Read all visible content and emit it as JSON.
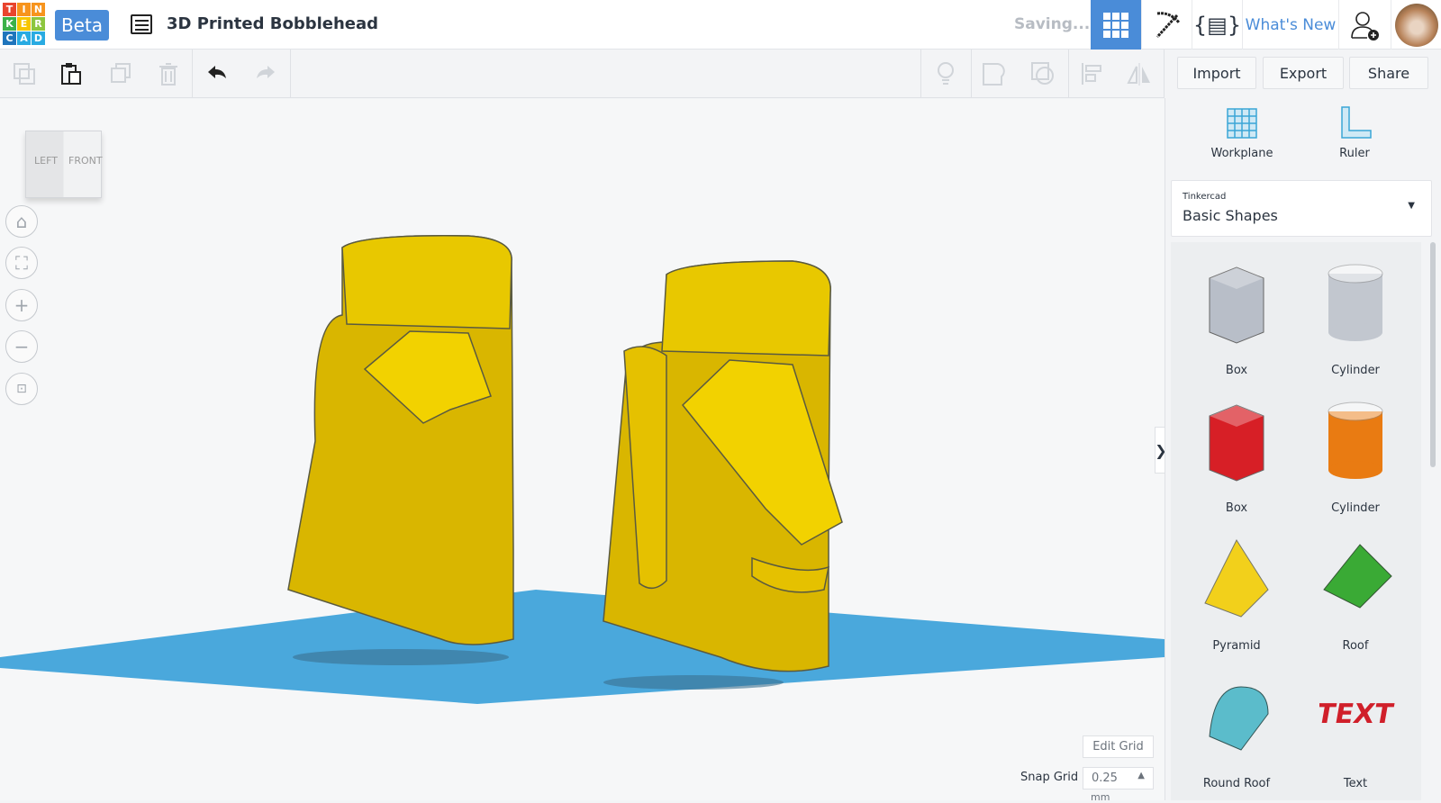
{
  "header": {
    "logo_letters": [
      "T",
      "I",
      "N",
      "K",
      "E",
      "R",
      "C",
      "A",
      "D"
    ],
    "logo_colors": [
      "#e8442e",
      "#f7941d",
      "#f7941d",
      "#3bb149",
      "#f7c500",
      "#8dc63f",
      "#1f75bc",
      "#29abe2",
      "#29abe2"
    ],
    "beta": "Beta",
    "title": "3D Printed Bobblehead",
    "status": "Saving...",
    "whats_new": "What's New"
  },
  "toolbar": {
    "import": "Import",
    "export": "Export",
    "share": "Share"
  },
  "viewcube": {
    "left": "LEFT",
    "front": "FRONT"
  },
  "panel": {
    "workplane": "Workplane",
    "ruler": "Ruler",
    "library_caption": "Tinkercad",
    "library_value": "Basic Shapes",
    "shapes": [
      {
        "label": "Box",
        "color": "#b8bec8"
      },
      {
        "label": "Cylinder",
        "color": "#c2c7cf"
      },
      {
        "label": "Box",
        "color": "#d71f26"
      },
      {
        "label": "Cylinder",
        "color": "#e97b12"
      },
      {
        "label": "Pyramid",
        "color": "#f2d01b"
      },
      {
        "label": "Roof",
        "color": "#3aaa35"
      },
      {
        "label": "Round Roof",
        "color": "#5bbccb"
      },
      {
        "label": "Text",
        "color": "#d01f2a"
      }
    ]
  },
  "grid": {
    "edit": "Edit Grid",
    "snap_label": "Snap Grid",
    "snap_value": "0.25",
    "unit": "mm"
  },
  "colors": {
    "accent": "#4a8cd8",
    "workplane": "#4aa8dc",
    "model": "#e5c100"
  }
}
